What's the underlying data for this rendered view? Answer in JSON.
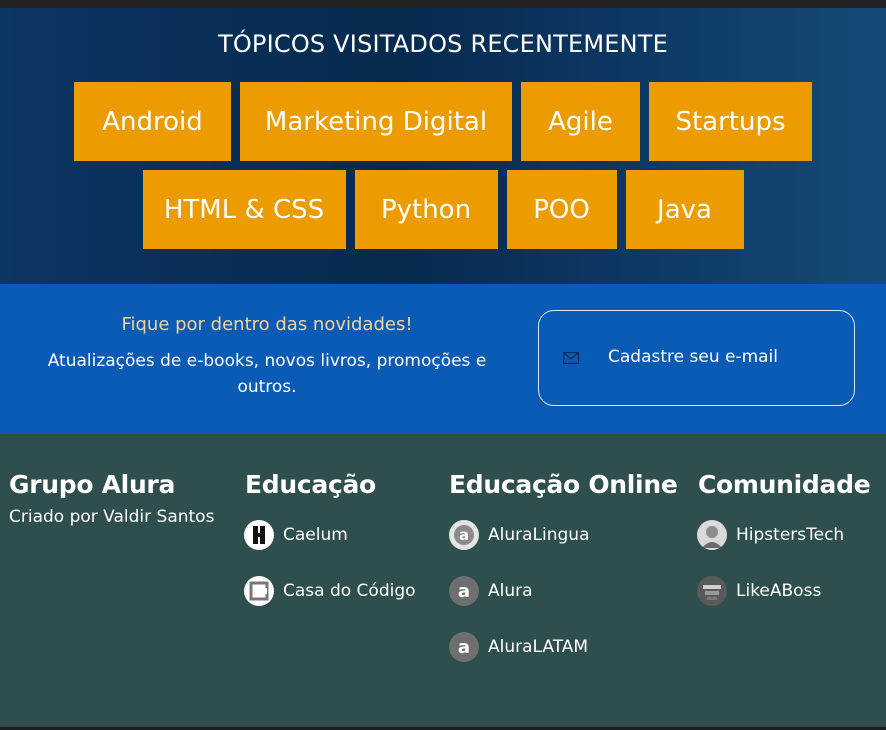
{
  "topics": {
    "title": "TÓPICOS VISITADOS RECENTEMENTE",
    "row1": [
      "Android",
      "Marketing Digital",
      "Agile",
      "Startups"
    ],
    "row2": [
      "HTML & CSS",
      "Python",
      "POO",
      "Java"
    ],
    "button_color": "#ec9c00"
  },
  "newsletter": {
    "heading": "Fique por dentro das novidades!",
    "text": "Atualizações de e-books, novos livros, promoções e outros.",
    "button_label": "Cadastre seu e-mail",
    "icon": "mail-icon",
    "background": "#0a5bb5"
  },
  "footer": {
    "background": "#2e4f4e",
    "grupo": {
      "title": "Grupo Alura",
      "subtitle": "Criado por Valdir Santos"
    },
    "educacao": {
      "title": "Educação",
      "links": [
        {
          "label": "Caelum",
          "icon": "caelum-icon"
        },
        {
          "label": "Casa do Código",
          "icon": "casa-do-codigo-icon"
        }
      ]
    },
    "educacao_online": {
      "title": "Educação Online",
      "links": [
        {
          "label": "AluraLingua",
          "icon": "aluralingua-icon"
        },
        {
          "label": "Alura",
          "icon": "alura-icon"
        },
        {
          "label": "AluraLATAM",
          "icon": "aluralatam-icon"
        }
      ]
    },
    "comunidade": {
      "title": "Comunidade",
      "links": [
        {
          "label": "HipstersTech",
          "icon": "hipsterstech-icon"
        },
        {
          "label": "LikeABoss",
          "icon": "likeaboss-icon"
        }
      ]
    }
  }
}
